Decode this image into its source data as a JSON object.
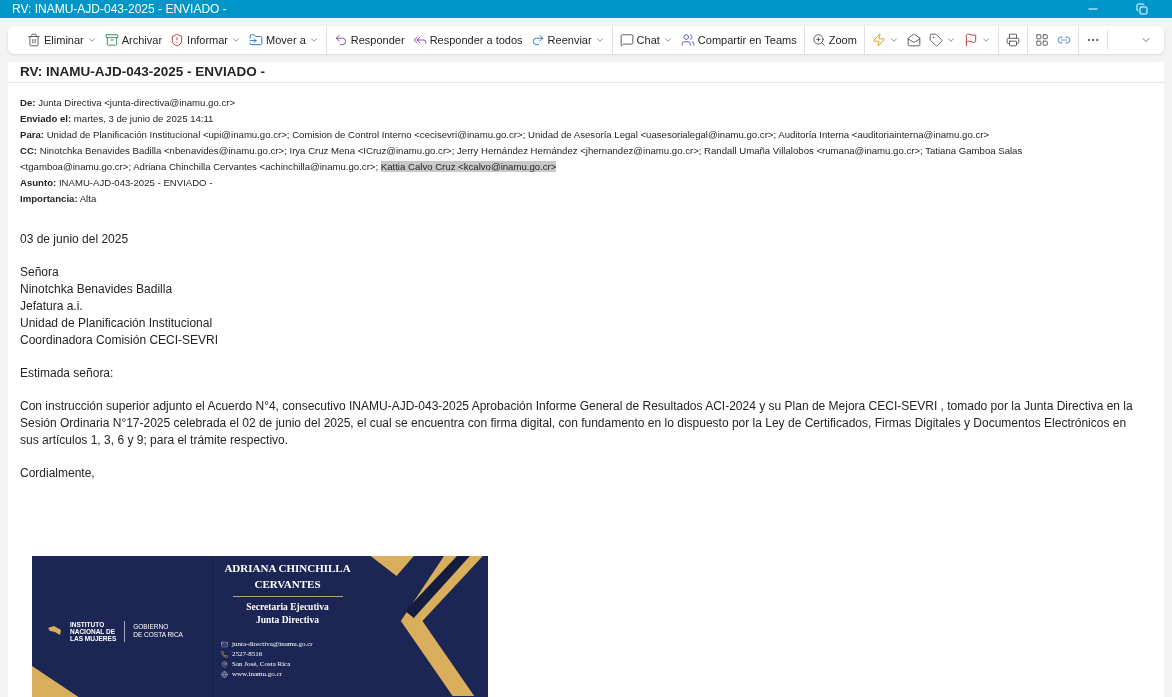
{
  "window": {
    "title": "RV: INAMU-AJD-043-2025 - ENVIADO -"
  },
  "toolbar": {
    "groups": [
      [
        {
          "label": "Eliminar",
          "dropdown": true
        },
        {
          "label": "Archivar",
          "dropdown": false
        },
        {
          "label": "Informar",
          "dropdown": true
        },
        {
          "label": "Mover a",
          "dropdown": true
        }
      ],
      [
        {
          "label": "Responder",
          "dropdown": false
        },
        {
          "label": "Responder a todos",
          "dropdown": false
        },
        {
          "label": "Reenviar",
          "dropdown": true
        }
      ],
      [
        {
          "label": "Chat",
          "dropdown": true
        },
        {
          "label": "Compartir en Teams",
          "dropdown": false
        }
      ],
      [
        {
          "label": "Zoom",
          "dropdown": false
        }
      ],
      [
        {
          "dropdown": true
        },
        {
          "dropdown": false
        },
        {
          "dropdown": true
        },
        {
          "dropdown": true
        }
      ],
      [
        {
          "dropdown": false
        }
      ],
      [
        {
          "dropdown": false
        },
        {
          "dropdown": false
        }
      ],
      [
        {
          "dropdown": false
        }
      ]
    ]
  },
  "subject": "RV: INAMU-AJD-043-2025 - ENVIADO -",
  "headers": [
    {
      "label": "De:",
      "parts": [
        {
          "text": "Junta Directiva <junta-directiva@inamu.go.cr>",
          "highlighted": false
        }
      ]
    },
    {
      "label": "Enviado el:",
      "parts": [
        {
          "text": "martes, 3 de junio de 2025 14:11",
          "highlighted": false
        }
      ]
    },
    {
      "label": "Para:",
      "parts": [
        {
          "text": "Unidad de Planificación Institucional <upi@inamu.go.cr>; Comision de Control Interno <cecisevri@inamu.go.cr>; Unidad de Asesoría Legal <uasesorialegal@inamu.go.cr>; Auditoría Interna <auditoriainterna@inamu.go.cr>",
          "highlighted": false
        }
      ]
    },
    {
      "label": "CC:",
      "parts": [
        {
          "text": "Ninotchka Benavides Badilla <nbenavides@inamu.go.cr>; Irya Cruz Mena <ICruz@inamu.go.cr>; Jerry Hernández Hernández <jhernandez@inamu.go.cr>; Randall Umaña Villalobos <rumana@inamu.go.cr>; Tatiana Gamboa Salas <tgamboa@inamu.go.cr>; Adriana Chinchilla Cervantes <achinchilla@inamu.go.cr>; ",
          "highlighted": false
        },
        {
          "text": "Kattia Calvo Cruz <kcalvo@inamu.go.cr>",
          "highlighted": true
        }
      ]
    },
    {
      "label": "Asunto:",
      "parts": [
        {
          "text": "INAMU-AJD-043-2025 - ENVIADO -",
          "highlighted": false
        }
      ]
    },
    {
      "label": "Importancia:",
      "parts": [
        {
          "text": "Alta",
          "highlighted": false
        }
      ]
    }
  ],
  "body": {
    "date": "03 de junio del  2025",
    "address": [
      "Señora",
      "Ninotchka Benavides Badilla",
      "Jefatura a.i.",
      "Unidad de Planificación Institucional",
      "Coordinadora Comisión CECI-SEVRI"
    ],
    "greeting": "Estimada señora:",
    "paragraph": "Con instrucción superior adjunto el Acuerdo N°4, consecutivo INAMU-AJD-043-2025 Aprobación Informe General de Resultados ACI-2024 y su Plan de Mejora CECI-SEVRI , tomado por la Junta Directiva en la Sesión Ordinaria N°17-2025 celebrada el 02 de junio del 2025, el cual se encuentra con firma digital, con fundamento en lo dispuesto por la Ley de Certificados, Firmas Digitales y Documentos Electrónicos en sus artículos 1, 3, 6 y 9; para el trámite respectivo.",
    "closing": "Cordialmente,"
  },
  "signature": {
    "logo_lines": [
      "INSTITUTO",
      "NACIONAL DE",
      "LAS MUJERES"
    ],
    "government_lines": [
      "GOBIERNO",
      "DE COSTA RICA"
    ],
    "name_lines": [
      "ADRIANA CHINCHILLA",
      "CERVANTES"
    ],
    "role_lines": [
      "Secretaria Ejecutiva",
      "Junta Directiva"
    ],
    "contacts": [
      {
        "kind": "email",
        "text": "junta-directiva@inamu.go.cr"
      },
      {
        "kind": "phone",
        "text": "2527-8516"
      },
      {
        "kind": "location",
        "text": "San José, Costa Rica"
      },
      {
        "kind": "web",
        "text": "www.inamu.go.cr"
      }
    ]
  }
}
